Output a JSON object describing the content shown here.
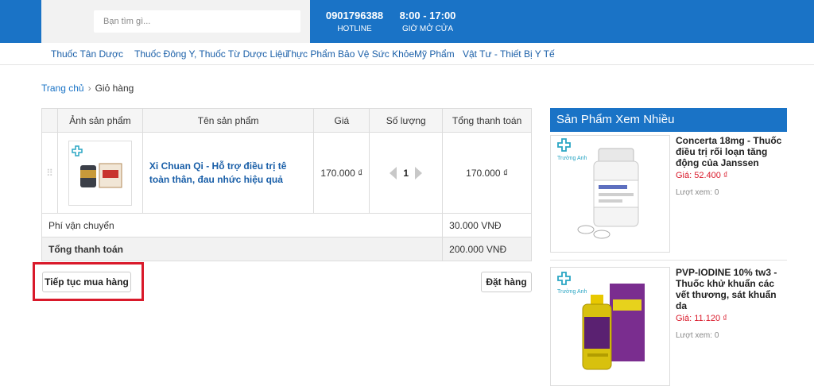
{
  "header": {
    "search_placeholder": "Bạn tìm gì...",
    "hotline_number": "0901796388",
    "hotline_label": "HOTLINE",
    "hours_value": "8:00 - 17:00",
    "hours_label": "GIỜ MỞ CỬA"
  },
  "nav": {
    "items": [
      {
        "label": "Thuốc Tân Dược"
      },
      {
        "label": "Thuốc Đông Y, Thuốc Từ Dược Liệu"
      },
      {
        "label": "Thực Phẩm Bảo Vệ Sức Khỏe"
      },
      {
        "label": "Mỹ Phẩm"
      },
      {
        "label": "Vật Tư - Thiết Bị Y Tế"
      }
    ]
  },
  "breadcrumb": {
    "home": "Trang chủ",
    "separator": "›",
    "current": "Giỏ hàng"
  },
  "cart": {
    "headers": {
      "image": "Ảnh sản phẩm",
      "name": "Tên sản phẩm",
      "price": "Giá",
      "quantity": "Số lượng",
      "total": "Tổng thanh toán"
    },
    "items": [
      {
        "name": "Xi Chuan Qi - Hỗ trợ điều trị tê toàn thân, đau nhức hiệu quả",
        "price": "170.000 ₫",
        "quantity": "1",
        "total": "170.000 ₫",
        "handle": "⠿"
      }
    ],
    "shipping_label": "Phí vận chuyển",
    "shipping_value": "30.000 VNĐ",
    "grand_total_label": "Tổng thanh toán",
    "grand_total_value": "200.000 VNĐ"
  },
  "buttons": {
    "continue_shopping": "Tiếp tục mua hàng",
    "place_order": "Đặt hàng"
  },
  "sidebar": {
    "title": "Sản Phẩm Xem Nhiều",
    "brand_text": "Trường Anh",
    "items": [
      {
        "name": "Concerta 18mg - Thuốc điều trị rối loạn tăng động của Janssen",
        "price": "Giá: 52.400 ₫",
        "views": "Lượt xem: 0"
      },
      {
        "name": "PVP-IODINE 10% tw3 - Thuốc khử khuẩn các vết thương, sát khuẩn da",
        "price": "Giá: 11.120 ₫",
        "views": "Lượt xem: 0"
      }
    ]
  },
  "colors": {
    "brand_blue": "#1a73c6",
    "link_blue": "#1a5fa8",
    "price_red": "#d9192a",
    "highlight_red": "#d9192a"
  }
}
